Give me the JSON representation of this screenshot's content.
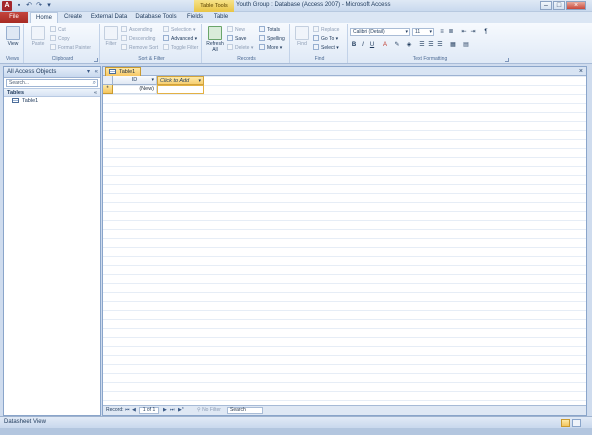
{
  "window": {
    "app_icon": "A",
    "context_tab": "Table Tools",
    "title": "Youth Group : Database (Access 2007) - Microsoft Access",
    "qat_icons": [
      "save-icon",
      "undo-icon",
      "redo-icon",
      "customize-qat-icon"
    ]
  },
  "tabs": {
    "file": "File",
    "home": "Home",
    "create": "Create",
    "external_data": "External Data",
    "database_tools": "Database Tools",
    "fields": "Fields",
    "table": "Table"
  },
  "ribbon": {
    "views": {
      "view_label": "View",
      "group": "Views"
    },
    "clipboard": {
      "paste": "Paste",
      "cut": "Cut",
      "copy": "Copy",
      "format_painter": "Format Painter",
      "group": "Clipboard"
    },
    "sort_filter": {
      "filter": "Filter",
      "ascending": "Ascending",
      "descending": "Descending",
      "remove_sort": "Remove Sort",
      "selection": "Selection",
      "advanced": "Advanced",
      "toggle_filter": "Toggle Filter",
      "group": "Sort & Filter"
    },
    "records": {
      "refresh": "Refresh",
      "refresh_sub": "All",
      "new": "New",
      "save": "Save",
      "delete": "Delete",
      "totals": "Totals",
      "spelling": "Spelling",
      "more": "More",
      "group": "Records"
    },
    "find": {
      "find": "Find",
      "replace": "Replace",
      "goto": "Go To",
      "select": "Select",
      "group": "Find"
    },
    "text_formatting": {
      "font": "Calibri (Detail)",
      "size": "11",
      "bold": "B",
      "italic": "I",
      "underline": "U",
      "group": "Text Formatting"
    }
  },
  "nav": {
    "header": "All Access Objects",
    "search_placeholder": "Search...",
    "group": "Tables",
    "items": [
      {
        "label": "Table1"
      }
    ]
  },
  "document": {
    "tab": "Table1",
    "columns": [
      "ID",
      "Click to Add"
    ],
    "new_row_marker": "*",
    "new_row_value": "(New)"
  },
  "record_nav": {
    "label": "Record:",
    "position": "1 of 1",
    "filter_status": "No Filter",
    "search": "Search"
  },
  "status": {
    "text": "Datasheet View"
  }
}
